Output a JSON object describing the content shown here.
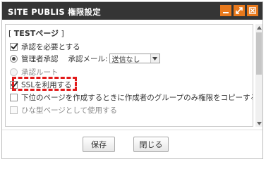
{
  "dialog": {
    "title": "SITE PUBLIS 権限設定",
    "accent_color": "#e8791c"
  },
  "section": {
    "bracket_open": "[ ",
    "name": "TESTページ",
    "bracket_close": " ]"
  },
  "options": {
    "require_approval": {
      "label": "承認を必要とする",
      "checked": true
    },
    "admin_approval": {
      "label": "管理者承認",
      "selected": true
    },
    "approval_mail": {
      "label": "承認メール:",
      "value": "送信なし"
    },
    "approval_route": {
      "label": "承認ルート",
      "selected": false
    },
    "use_ssl": {
      "label": "SSLを利用する",
      "checked": true
    },
    "copy_group_permission": {
      "label": "下位のページを作成するときに作成者のグループのみ権限をコピーする",
      "checked": false
    },
    "use_as_template": {
      "label": "ひな型ページとして使用する",
      "checked": false
    }
  },
  "buttons": {
    "save": "保存",
    "close": "閉じる"
  }
}
